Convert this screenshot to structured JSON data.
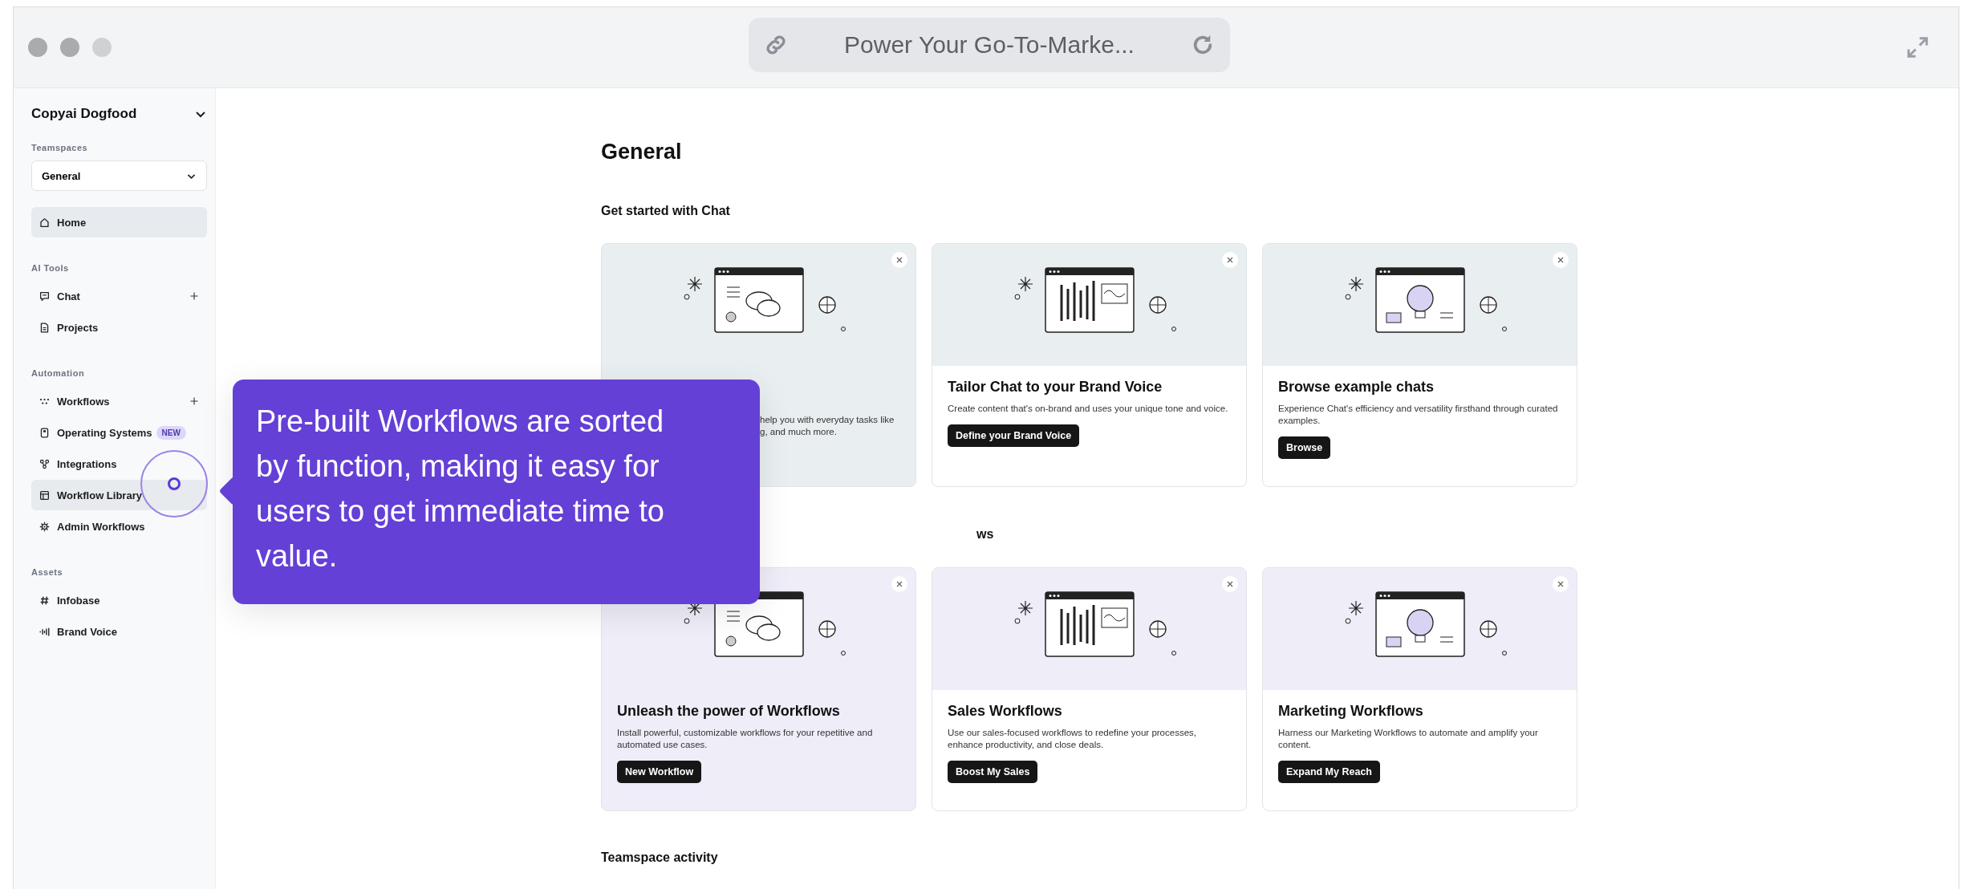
{
  "window": {
    "title": "Power Your Go-To-Marke..."
  },
  "sidebar": {
    "workspace": "Copyai Dogfood",
    "teamspaces_label": "Teamspaces",
    "teamspace": "General",
    "home": {
      "label": "Home",
      "selected": true
    },
    "groups": [
      {
        "heading": "AI Tools",
        "items": [
          {
            "label": "Chat",
            "selected": false,
            "add_button": true
          },
          {
            "label": "Projects",
            "selected": false,
            "add_button": false
          }
        ]
      },
      {
        "heading": "Automation",
        "items": [
          {
            "label": "Workflows",
            "selected": false,
            "add_button": true
          },
          {
            "label": "Operating Systems",
            "badge": "NEW",
            "selected": false,
            "add_button": false
          },
          {
            "label": "Integrations",
            "selected": false,
            "add_button": false
          },
          {
            "label": "Workflow Library",
            "selected": true,
            "add_button": false
          },
          {
            "label": "Admin Workflows",
            "selected": false,
            "add_button": false
          }
        ]
      },
      {
        "heading": "Assets",
        "items": [
          {
            "label": "Infobase",
            "selected": false,
            "add_button": false
          },
          {
            "label": "Brand Voice",
            "selected": false,
            "add_button": false
          }
        ]
      }
    ]
  },
  "main": {
    "title": "General",
    "sections": [
      {
        "heading": "Get started with Chat",
        "color": "#e9eef0",
        "cards": [
          {
            "highlighted": true,
            "description_lines": [
              "help you with everyday tasks like",
              "g, and much more."
            ]
          },
          {
            "highlighted": false,
            "title": "Tailor Chat to your Brand Voice",
            "description": "Create content that's on-brand and uses your unique tone and voice.",
            "button": "Define your Brand Voice"
          },
          {
            "highlighted": false,
            "title": "Browse example chats",
            "description": "Experience Chat's efficiency and versatility firsthand through curated examples.",
            "button": "Browse"
          }
        ]
      },
      {
        "heading": "ws",
        "color": "#eeedf8",
        "cards": [
          {
            "highlighted": true,
            "title": "Unleash the power of Workflows",
            "description": "Install powerful, customizable workflows for your repetitive and automated use cases.",
            "button": "New Workflow"
          },
          {
            "highlighted": false,
            "title": "Sales Workflows",
            "description": "Use our sales-focused workflows to redefine your processes, enhance productivity, and close deals.",
            "button": "Boost My Sales"
          },
          {
            "highlighted": false,
            "title": "Marketing Workflows",
            "description": "Harness our Marketing Workflows to automate and amplify your content.",
            "button": "Expand My Reach"
          }
        ]
      }
    ],
    "activity_heading": "Teamspace activity"
  },
  "tooltip": {
    "text": "Pre-built Workflows are sorted by function, making it easy for users to get immediate time to value."
  }
}
